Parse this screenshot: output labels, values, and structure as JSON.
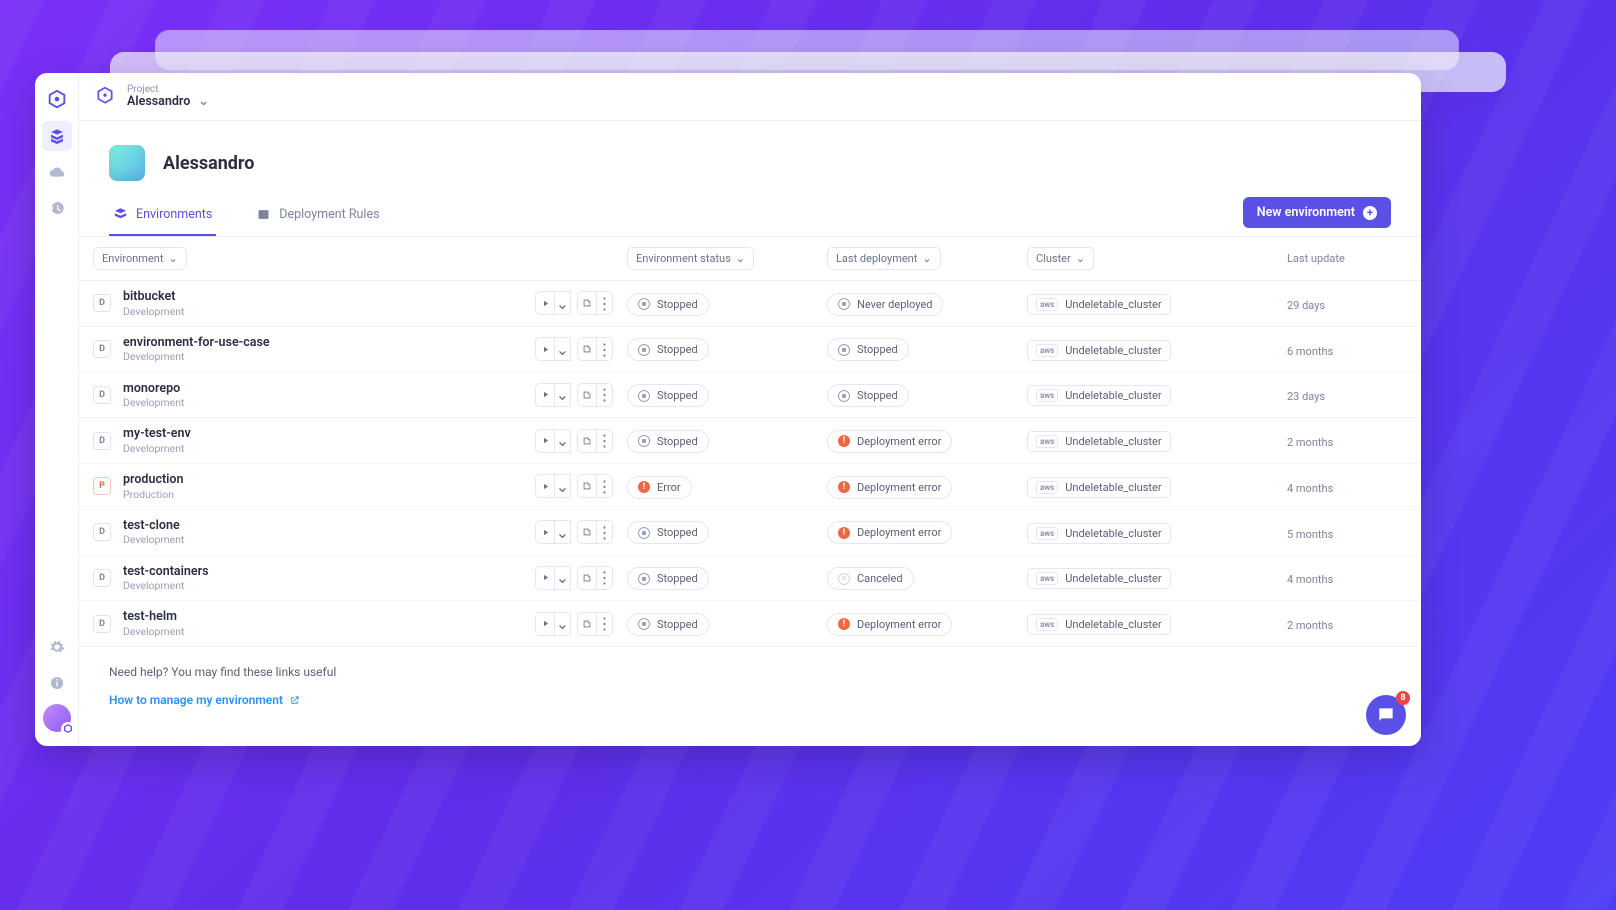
{
  "project_label": "Project",
  "project_name": "Alessandro",
  "page_title": "Alessandro",
  "tabs": {
    "environments": "Environments",
    "rules": "Deployment Rules"
  },
  "new_button": "New environment",
  "columns": {
    "env": "Environment",
    "status": "Environment status",
    "deploy": "Last deployment",
    "cluster": "Cluster",
    "update": "Last update"
  },
  "cluster_provider": "aws",
  "rows": [
    {
      "badge": "D",
      "type": "dev",
      "name": "bitbucket",
      "sub": "Development",
      "status": "Stopped",
      "status_kind": "stopped",
      "deploy": "Never deployed",
      "deploy_kind": "stopped",
      "cluster": "Undeletable_cluster",
      "update": "29 days"
    },
    {
      "badge": "D",
      "type": "dev",
      "name": "environment-for-use-case",
      "sub": "Development",
      "status": "Stopped",
      "status_kind": "stopped",
      "deploy": "Stopped",
      "deploy_kind": "stopped",
      "cluster": "Undeletable_cluster",
      "update": "6 months"
    },
    {
      "badge": "D",
      "type": "dev",
      "name": "monorepo",
      "sub": "Development",
      "status": "Stopped",
      "status_kind": "stopped",
      "deploy": "Stopped",
      "deploy_kind": "stopped",
      "cluster": "Undeletable_cluster",
      "update": "23 days"
    },
    {
      "badge": "D",
      "type": "dev",
      "name": "my-test-env",
      "sub": "Development",
      "status": "Stopped",
      "status_kind": "stopped",
      "deploy": "Deployment error",
      "deploy_kind": "error",
      "cluster": "Undeletable_cluster",
      "update": "2 months"
    },
    {
      "badge": "P",
      "type": "prod",
      "name": "production",
      "sub": "Production",
      "status": "Error",
      "status_kind": "error",
      "deploy": "Deployment error",
      "deploy_kind": "error",
      "cluster": "Undeletable_cluster",
      "update": "4 months"
    },
    {
      "badge": "D",
      "type": "dev",
      "name": "test-clone",
      "sub": "Development",
      "status": "Stopped",
      "status_kind": "stopped",
      "deploy": "Deployment error",
      "deploy_kind": "error",
      "cluster": "Undeletable_cluster",
      "update": "5 months"
    },
    {
      "badge": "D",
      "type": "dev",
      "name": "test-containers",
      "sub": "Development",
      "status": "Stopped",
      "status_kind": "stopped",
      "deploy": "Canceled",
      "deploy_kind": "canceled",
      "cluster": "Undeletable_cluster",
      "update": "4 months"
    },
    {
      "badge": "D",
      "type": "dev",
      "name": "test-helm",
      "sub": "Development",
      "status": "Stopped",
      "status_kind": "stopped",
      "deploy": "Deployment error",
      "deploy_kind": "error",
      "cluster": "Undeletable_cluster",
      "update": "2 months"
    }
  ],
  "help_title": "Need help? You may find these links useful",
  "help_link": "How to manage my environment",
  "chat_badge": "8"
}
